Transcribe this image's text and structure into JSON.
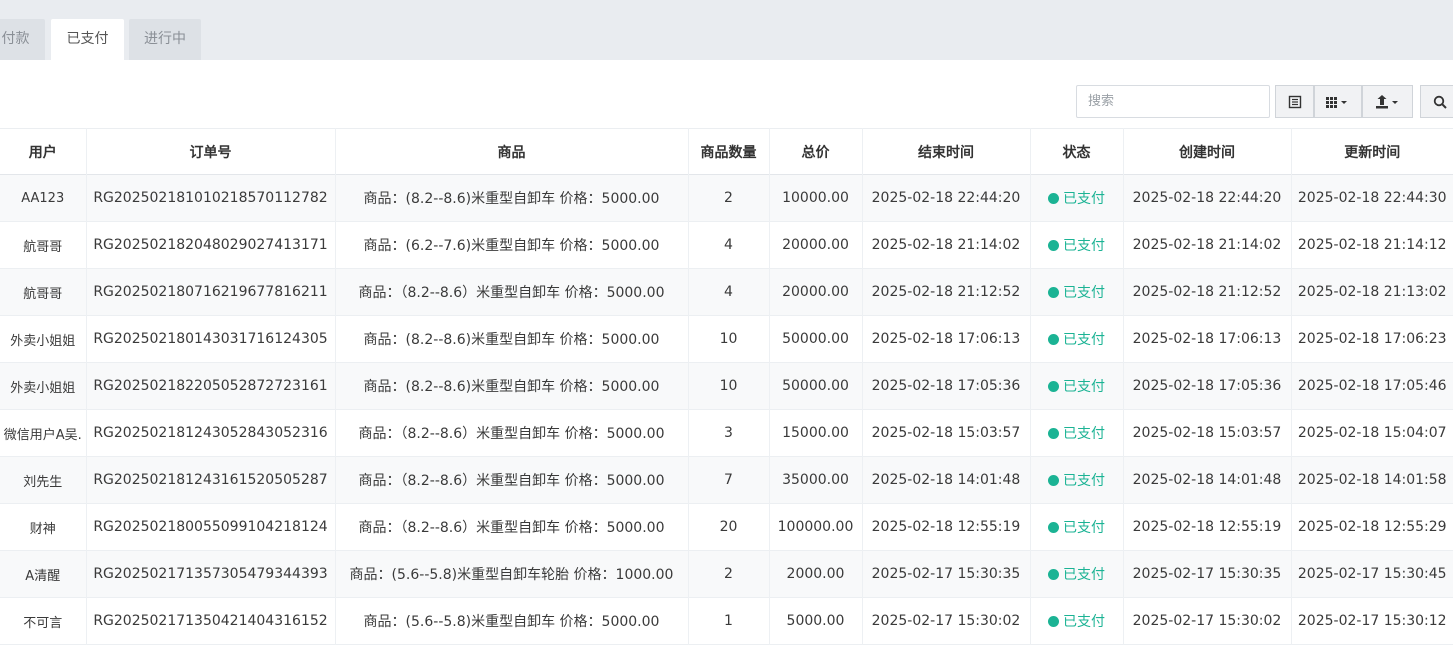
{
  "tabs": [
    {
      "label": "待付款",
      "display": "付款"
    },
    {
      "label": "已支付"
    },
    {
      "label": "进行中"
    }
  ],
  "toolbar": {
    "search_placeholder": "搜索",
    "icons": [
      "list-icon",
      "columns-icon",
      "export-icon",
      "search-icon"
    ]
  },
  "table": {
    "columns": [
      "用户",
      "订单号",
      "商品",
      "商品数量",
      "总价",
      "结束时间",
      "状态",
      "创建时间",
      "更新时间"
    ],
    "rows": [
      {
        "user": "AA123",
        "order": "RG20250218101021857011278​2",
        "product": "商品：(8.2--8.6)米重型自卸车 价格：5000.00",
        "qty": "2",
        "total": "10000.00",
        "end": "2025-02-18 22:44:20",
        "status": "已支付",
        "created": "2025-02-18 22:44:20",
        "updated": "2025-02-18 22:44:30"
      },
      {
        "user": "航哥哥",
        "order": "RG20250218204802902741317​1",
        "product": "商品：(6.2--7.6)米重型自卸车 价格：5000.00",
        "qty": "4",
        "total": "20000.00",
        "end": "2025-02-18 21:14:02",
        "status": "已支付",
        "created": "2025-02-18 21:14:02",
        "updated": "2025-02-18 21:14:12"
      },
      {
        "user": "航哥哥",
        "order": "RG20250218071621967781621​1",
        "product": "商品：（8.2--8.6）米重型自卸车 价格：5000.00",
        "qty": "4",
        "total": "20000.00",
        "end": "2025-02-18 21:12:52",
        "status": "已支付",
        "created": "2025-02-18 21:12:52",
        "updated": "2025-02-18 21:13:02"
      },
      {
        "user": "外卖小姐姐",
        "order": "RG20250218014303171612430​5",
        "product": "商品：(8.2--8.6)米重型自卸车 价格：5000.00",
        "qty": "10",
        "total": "50000.00",
        "end": "2025-02-18 17:06:13",
        "status": "已支付",
        "created": "2025-02-18 17:06:13",
        "updated": "2025-02-18 17:06:23"
      },
      {
        "user": "外卖小姐姐",
        "order": "RG20250218220505287272316​1",
        "product": "商品：(8.2--8.6)米重型自卸车 价格：5000.00",
        "qty": "10",
        "total": "50000.00",
        "end": "2025-02-18 17:05:36",
        "status": "已支付",
        "created": "2025-02-18 17:05:36",
        "updated": "2025-02-18 17:05:46"
      },
      {
        "user": "微信用户A吴.",
        "order": "RG20250218124305284305231​6",
        "product": "商品：（8.2--8.6）米重型自卸车 价格：5000.00",
        "qty": "3",
        "total": "15000.00",
        "end": "2025-02-18 15:03:57",
        "status": "已支付",
        "created": "2025-02-18 15:03:57",
        "updated": "2025-02-18 15:04:07"
      },
      {
        "user": "刘先生",
        "order": "RG20250218124316152050528​7",
        "product": "商品：（8.2--8.6）米重型自卸车 价格：5000.00",
        "qty": "7",
        "total": "35000.00",
        "end": "2025-02-18 14:01:48",
        "status": "已支付",
        "created": "2025-02-18 14:01:48",
        "updated": "2025-02-18 14:01:58"
      },
      {
        "user": "财神",
        "order": "RG20250218005509910421812​4",
        "product": "商品：（8.2--8.6）米重型自卸车 价格：5000.00",
        "qty": "20",
        "total": "100000.00",
        "end": "2025-02-18 12:55:19",
        "status": "已支付",
        "created": "2025-02-18 12:55:19",
        "updated": "2025-02-18 12:55:29"
      },
      {
        "user": "A清醒",
        "order": "RG20250217135730547934439​3",
        "product": "商品：(5.6--5.8)米重型自卸车轮胎 价格：1000.00",
        "qty": "2",
        "total": "2000.00",
        "end": "2025-02-17 15:30:35",
        "status": "已支付",
        "created": "2025-02-17 15:30:35",
        "updated": "2025-02-17 15:30:45"
      },
      {
        "user": "不可言",
        "order": "RG20250217135042140431615​2",
        "product": "商品：(5.6--5.8)米重型自卸车 价格：5000.00",
        "qty": "1",
        "total": "5000.00",
        "end": "2025-02-17 15:30:02",
        "status": "已支付",
        "created": "2025-02-17 15:30:02",
        "updated": "2025-02-17 15:30:12"
      }
    ]
  },
  "colors": {
    "status_paid": "#1bb394",
    "tabbar_bg": "#e9ecf0"
  }
}
